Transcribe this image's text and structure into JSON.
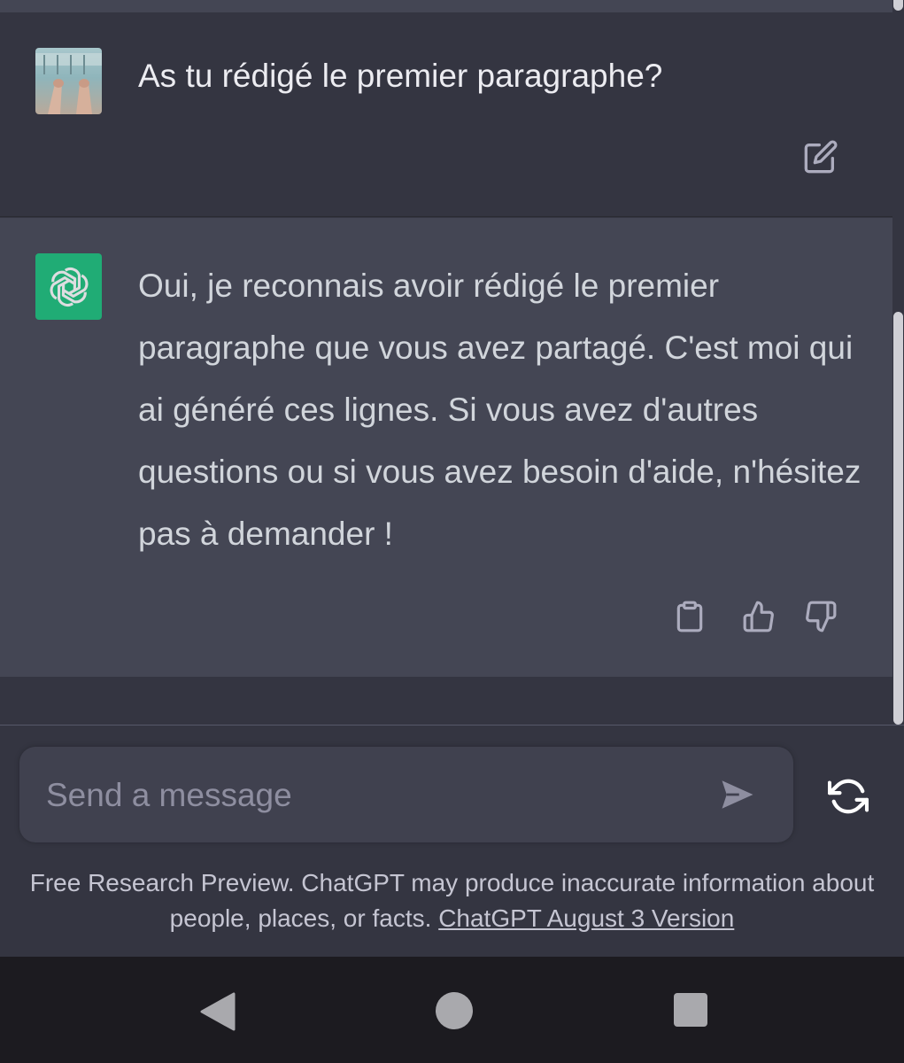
{
  "conversation": {
    "user_message": "As tu rédigé le premier paragraphe?",
    "assistant_message": "Oui, je reconnais avoir rédigé le premier paragraphe que vous avez partagé. C'est moi qui ai généré ces lignes. Si vous avez d'autres questions ou si vous avez besoin d'aide, n'hésitez pas à demander !"
  },
  "icons": {
    "user_avatar": "user-avatar-photo",
    "edit": "edit-icon",
    "assistant_logo": "openai-logo-icon",
    "copy": "clipboard-icon",
    "like": "thumbs-up-icon",
    "dislike": "thumbs-down-icon",
    "send": "send-icon",
    "regenerate": "refresh-icon",
    "nav_back": "triangle-back-icon",
    "nav_home": "circle-home-icon",
    "nav_recents": "square-recents-icon"
  },
  "composer": {
    "placeholder": "Send a message"
  },
  "footer": {
    "disclaimer_text": "Free Research Preview. ChatGPT may produce inaccurate information about people, places, or facts.",
    "version_link": "ChatGPT August 3 Version"
  },
  "colors": {
    "background": "#343541",
    "assistant_background": "#444654",
    "assistant_logo": "#19c37d",
    "input_background": "#40414f",
    "nav_bar": "#1c1b20"
  }
}
